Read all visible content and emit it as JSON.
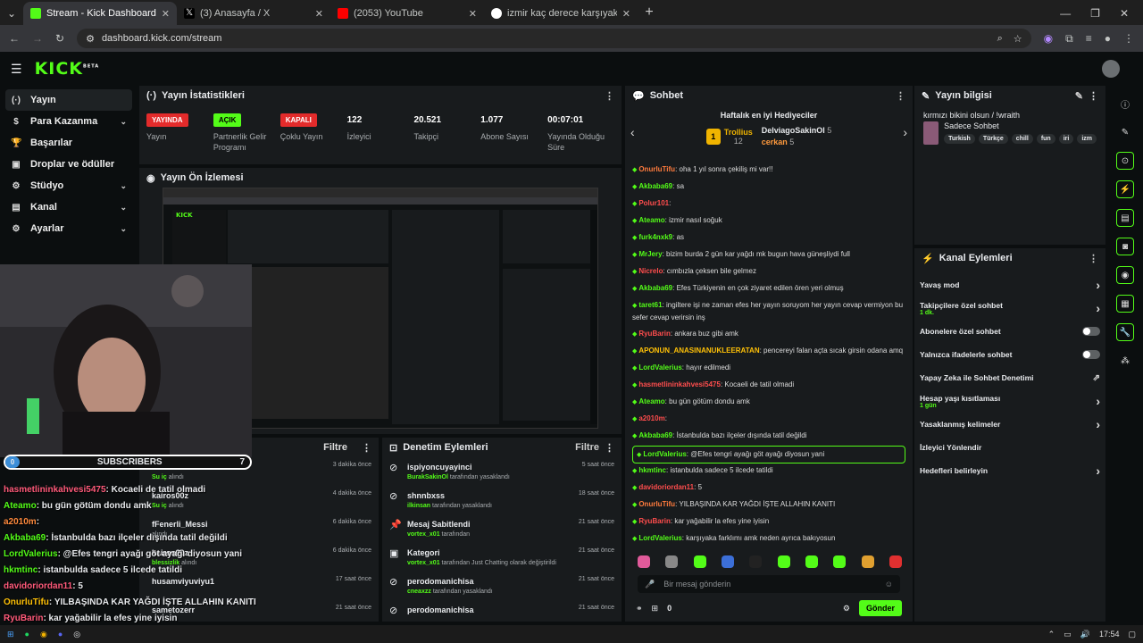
{
  "browser": {
    "tabs": [
      {
        "title": "Stream - Kick Dashboard",
        "icon_color": "#53fc18",
        "active": true
      },
      {
        "title": "(3) Anasayfa / X",
        "icon_color": "#000000",
        "active": false
      },
      {
        "title": "(2053) YouTube",
        "icon_color": "#ff0000",
        "active": false
      },
      {
        "title": "izmir kaç derece karşıyaka - Go",
        "icon_color": "#4285f4",
        "active": false
      }
    ],
    "url": "dashboard.kick.com/stream"
  },
  "kick": {
    "logo": "KICK",
    "beta": "BETA"
  },
  "sidebar": {
    "items": [
      {
        "label": "Yayın",
        "icon": "(·)",
        "chevron": false,
        "active": true
      },
      {
        "label": "Para Kazanma",
        "icon": "$",
        "chevron": true
      },
      {
        "label": "Başarılar",
        "icon": "🏆",
        "chevron": false
      },
      {
        "label": "Droplar ve ödüller",
        "icon": "▣",
        "chevron": false
      },
      {
        "label": "Stüdyo",
        "icon": "⚙",
        "chevron": true
      },
      {
        "label": "Kanal",
        "icon": "▤",
        "chevron": true
      },
      {
        "label": "Ayarlar",
        "icon": "⚙",
        "chevron": true
      }
    ]
  },
  "stats": {
    "title": "Yayın İstatistikleri",
    "cols": [
      {
        "badge": "YAYINDA",
        "badge_bg": "#e32b2b",
        "badge_fg": "#ffffff",
        "label": "Yayın"
      },
      {
        "badge": "AÇIK",
        "badge_bg": "#53fc18",
        "badge_fg": "#000000",
        "label": "Partnerlik Gelir Programı"
      },
      {
        "badge": "KAPALI",
        "badge_bg": "#e32b2b",
        "badge_fg": "#ffffff",
        "label": "Çoklu Yayın"
      },
      {
        "value": "122",
        "label": "İzleyici"
      },
      {
        "value": "20.521",
        "label": "Takipçi"
      },
      {
        "value": "1.077",
        "label": "Abone Sayısı"
      },
      {
        "value": "00:07:01",
        "label": "Yayında Olduğu Süre"
      }
    ]
  },
  "preview": {
    "title": "Yayın Ön İzlemesi"
  },
  "recent": {
    "filter": "Filtre",
    "rows": [
      {
        "name": "kairos00z",
        "sub": "Su iç",
        "sub2": "alındı",
        "time": "3 dakika önce"
      },
      {
        "name": "kairos00z",
        "sub": "Su iç",
        "sub2": "alındı",
        "time": "4 dakika önce"
      },
      {
        "name": "fFenerli_Messi",
        "sub": "",
        "sub2": "alındı",
        "time": "6 dakika önce"
      },
      {
        "name": "kairos00z",
        "sub": "blessizlik",
        "sub2": "alındı",
        "time": "6 dakika önce"
      },
      {
        "name": "husamviyuviyu1",
        "sub": "",
        "sub2": "",
        "time": "17 saat önce"
      },
      {
        "name": "sametozerr",
        "sub": "",
        "sub2": "",
        "time": "21 saat önce"
      }
    ]
  },
  "mod": {
    "title": "Denetim Eylemleri",
    "filter": "Filtre",
    "rows": [
      {
        "name": "ispiyoncuyayinci",
        "actor": "BurakSakinOl",
        "rest": "tarafından yasaklandı",
        "time": "5 saat önce",
        "icon": "⊘"
      },
      {
        "name": "shnnbxss",
        "actor": "ilkinsan",
        "rest": "tarafından yasaklandı",
        "time": "18 saat önce",
        "icon": "⊘"
      },
      {
        "name": "Mesaj Sabitlendi",
        "actor": "vortex_x01",
        "rest": "tarafından",
        "time": "21 saat önce",
        "icon": "📌"
      },
      {
        "name": "Kategori",
        "actor": "vortex_x01",
        "rest": "tarafından Just Chatting olarak değiştirildi",
        "time": "21 saat önce",
        "icon": "▣"
      },
      {
        "name": "perodomanichisa",
        "actor": "cneaxzz",
        "rest": "tarafından yasaklandı",
        "time": "21 saat önce",
        "icon": "⊘"
      },
      {
        "name": "perodomanichisa",
        "actor": "",
        "rest": "",
        "time": "21 saat önce",
        "icon": "⊘"
      }
    ]
  },
  "overlay": {
    "subs_left": "0",
    "subs_label": "SUBSCRIBERS",
    "subs_right": "7",
    "chat": [
      {
        "user": "hasmetlininkahvesi5475",
        "color": "#ff5a7a",
        "text": ": Kocaeli de tatil olmadi"
      },
      {
        "user": "Ateamo",
        "color": "#53fc18",
        "text": ": bu gün götüm dondu amk"
      },
      {
        "user": "a2010m",
        "color": "#ff8a3d",
        "text": ":"
      },
      {
        "user": "Akbaba69",
        "color": "#53fc18",
        "text": ": İstanbulda bazı ilçeler dışında tatil değildi"
      },
      {
        "user": "LordValerius",
        "color": "#53fc18",
        "text": ": @Efes tengri ayağı göt ayağı diyosun yani"
      },
      {
        "user": "hkmtinc",
        "color": "#53fc18",
        "text": ": istanbulda sadece 5 ilcede tatildi"
      },
      {
        "user": "davidoriordan11",
        "color": "#ff5a7a",
        "text": ": 5"
      },
      {
        "user": "OnurluTifu",
        "color": "#ffc107",
        "text": ": YILBAŞINDA KAR YAĞDI İŞTE ALLAHIN KANITI"
      },
      {
        "user": "RyuBarin",
        "color": "#ff5a7a",
        "text": ": kar yağabilir la efes yine iyisin"
      }
    ]
  },
  "chat": {
    "title": "Sohbet",
    "gifters_title": "Haftalık en iyi Hediyeciler",
    "first": {
      "name": "Trollius",
      "count": "12"
    },
    "others": [
      {
        "name": "DelviagoSakinOl",
        "count": "5"
      },
      {
        "name": "cerkan",
        "count": "5"
      }
    ],
    "messages": [
      {
        "user": "OnurluTifu",
        "color": "#ff7b3d",
        "text": ": oha 1 yıl sonra çekiliş mi var!!"
      },
      {
        "user": "Akbaba69",
        "color": "#53fc18",
        "text": ": sa"
      },
      {
        "user": "Polur101",
        "color": "#ff4d4d",
        "text": ":"
      },
      {
        "user": "Ateamo",
        "color": "#53fc18",
        "text": ": izmir nasıl soğuk"
      },
      {
        "user": "furk4nxk9",
        "color": "#53fc18",
        "text": ": as"
      },
      {
        "user": "MrJery",
        "color": "#53fc18",
        "text": ": bizim burda 2 gün kar yağdı mk bugun hava güneşliydi full"
      },
      {
        "user": "Nicrelo",
        "color": "#ff4d4d",
        "text": ": cımbızla çeksen bile gelmez"
      },
      {
        "user": "Akbaba69",
        "color": "#53fc18",
        "text": ": Efes Türkiyenin en çok ziyaret edilen ören yeri olmuş"
      },
      {
        "user": "taret61",
        "color": "#53fc18",
        "text": ": ingiltere işi ne zaman efes her yayın soruyom her yayın cevap vermiyon bu sefer cevap verirsin inş"
      },
      {
        "user": "RyuBarin",
        "color": "#ff4d4d",
        "text": ": ankara buz gibi amk"
      },
      {
        "user": "APONUN_ANASINANUKLEERATAN",
        "color": "#ffc107",
        "text": ": pencereyi falan açta sıcak girsin odana amq"
      },
      {
        "user": "LordValerius",
        "color": "#53fc18",
        "text": ": hayır edilmedi"
      },
      {
        "user": "hasmetlininkahvesi5475",
        "color": "#ff4d4d",
        "text": ": Kocaeli de tatil olmadi"
      },
      {
        "user": "Ateamo",
        "color": "#53fc18",
        "text": ": bu gün götüm dondu amk"
      },
      {
        "user": "a2010m",
        "color": "#ff4d4d",
        "text": ":"
      },
      {
        "user": "Akbaba69",
        "color": "#53fc18",
        "text": ": İstanbulda bazı ilçeler dışında tatil değildi"
      },
      {
        "user": "LordValerius",
        "color": "#53fc18",
        "text": ": @Efes tengri ayağı göt ayağı diyosun yani",
        "hl": true
      },
      {
        "user": "hkmtinc",
        "color": "#53fc18",
        "text": ": istanbulda sadece 5 ilcede tatildi"
      },
      {
        "user": "davidoriordan11",
        "color": "#ff4d4d",
        "text": ": 5"
      },
      {
        "user": "OnurluTifu",
        "color": "#ff7b3d",
        "text": ": YILBAŞINDA KAR YAĞDI İŞTE ALLAHIN KANITI"
      },
      {
        "user": "RyuBarin",
        "color": "#ff4d4d",
        "text": ": kar yağabilir la efes yine iyisin"
      },
      {
        "user": "LordValerius",
        "color": "#53fc18",
        "text": ": karşıyaka farklımı amk neden ayrıca bakıyosun"
      }
    ],
    "input_placeholder": "Bir mesaj gönderin",
    "points": "0",
    "send": "Gönder"
  },
  "info": {
    "title": "Yayın bilgisi",
    "stream_title": "kırmızı bikini olsun / !wraith",
    "category": "Sadece Sohbet",
    "tags": [
      "Turkish",
      "Türkçe",
      "chill",
      "fun",
      "iri",
      "izm"
    ]
  },
  "actions": {
    "title": "Kanal Eylemleri",
    "items": [
      {
        "label": "Yavaş mod",
        "sub": "",
        "ctrl": "arrow"
      },
      {
        "label": "Takipçilere özel sohbet",
        "sub": "1 dk.",
        "ctrl": "arrow"
      },
      {
        "label": "Abonelere özel sohbet",
        "sub": "",
        "ctrl": "toggle"
      },
      {
        "label": "Yalnızca ifadelerle sohbet",
        "sub": "",
        "ctrl": "toggle"
      },
      {
        "label": "Yapay Zeka ile Sohbet Denetimi",
        "sub": "",
        "ctrl": "ext"
      },
      {
        "label": "Hesap yaşı kısıtlaması",
        "sub": "1 gün",
        "ctrl": "arrow"
      },
      {
        "label": "Yasaklanmış kelimeler",
        "sub": "",
        "ctrl": "arrow"
      },
      {
        "label": "İzleyici Yönlendir",
        "sub": "",
        "ctrl": ""
      },
      {
        "label": "Hedefleri belirleyin",
        "sub": "",
        "ctrl": "arrow"
      }
    ]
  },
  "taskbar": {
    "time": "17:54"
  }
}
